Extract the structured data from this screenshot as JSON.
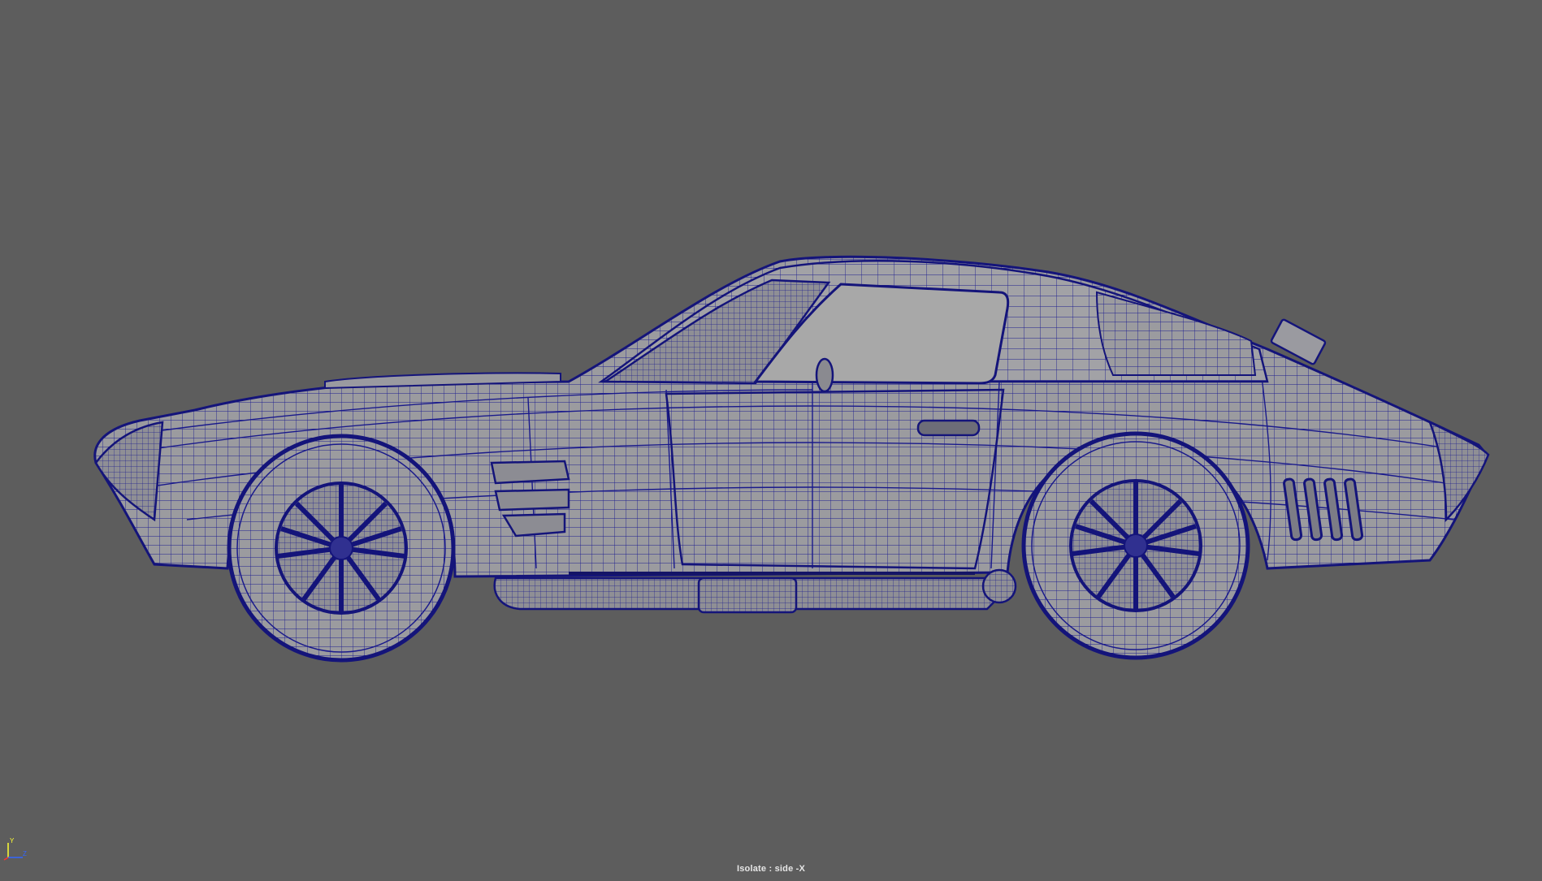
{
  "viewport": {
    "background_color": "#5d5d5d",
    "wire_color": "#1a1a8c",
    "shaded_color": "#9a9a9a",
    "camera_label": "Isolate : side -X"
  },
  "axis_gizmo": {
    "y_label": "Y",
    "z_label": "Z",
    "y_color": "#ffff33",
    "z_color": "#3366ff",
    "x_color": "#ff3333"
  },
  "model": {
    "icon": "car-wireframe-icon",
    "wheels": [
      "front-wheel",
      "rear-wheel"
    ]
  }
}
